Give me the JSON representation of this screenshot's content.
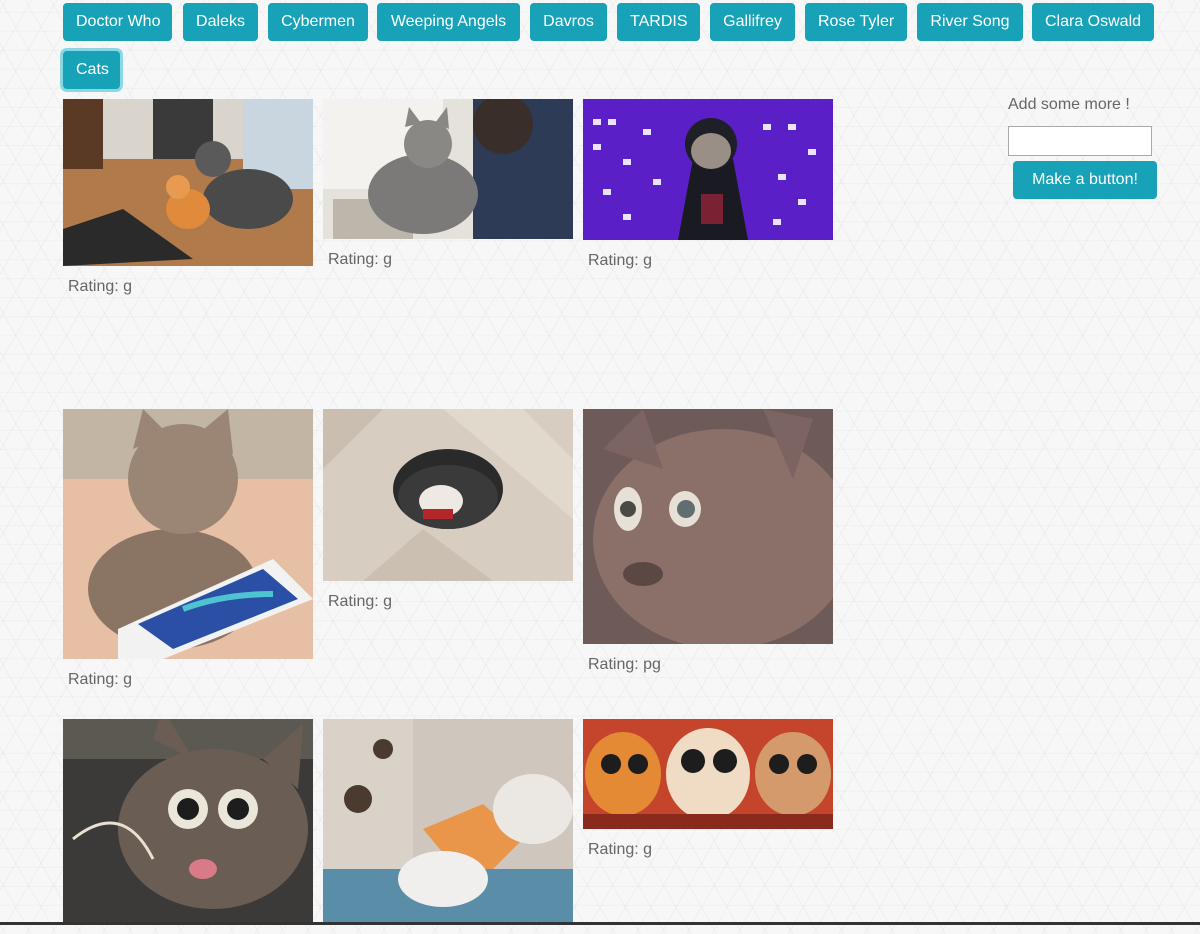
{
  "topics": [
    {
      "label": "Doctor Who"
    },
    {
      "label": "Daleks"
    },
    {
      "label": "Cybermen"
    },
    {
      "label": "Weeping Angels"
    },
    {
      "label": "Davros"
    },
    {
      "label": "TARDIS"
    },
    {
      "label": "Gallifrey"
    },
    {
      "label": "Rose Tyler"
    },
    {
      "label": "River Song"
    },
    {
      "label": "Clara Oswald"
    },
    {
      "label": "Cats",
      "active": true
    }
  ],
  "gifs": [
    {
      "rating": "Rating: g"
    },
    {
      "rating": "Rating: g"
    },
    {
      "rating": "Rating: g"
    },
    {
      "rating": "Rating: g"
    },
    {
      "rating": "Rating: g"
    },
    {
      "rating": "Rating: pg"
    },
    {
      "rating": ""
    },
    {
      "rating": ""
    },
    {
      "rating": "Rating: g"
    }
  ],
  "add_panel": {
    "label": "Add some more !",
    "input_value": "",
    "button_label": "Make a button!"
  },
  "colors": {
    "accent": "#17a2b8",
    "text": "#666666"
  }
}
